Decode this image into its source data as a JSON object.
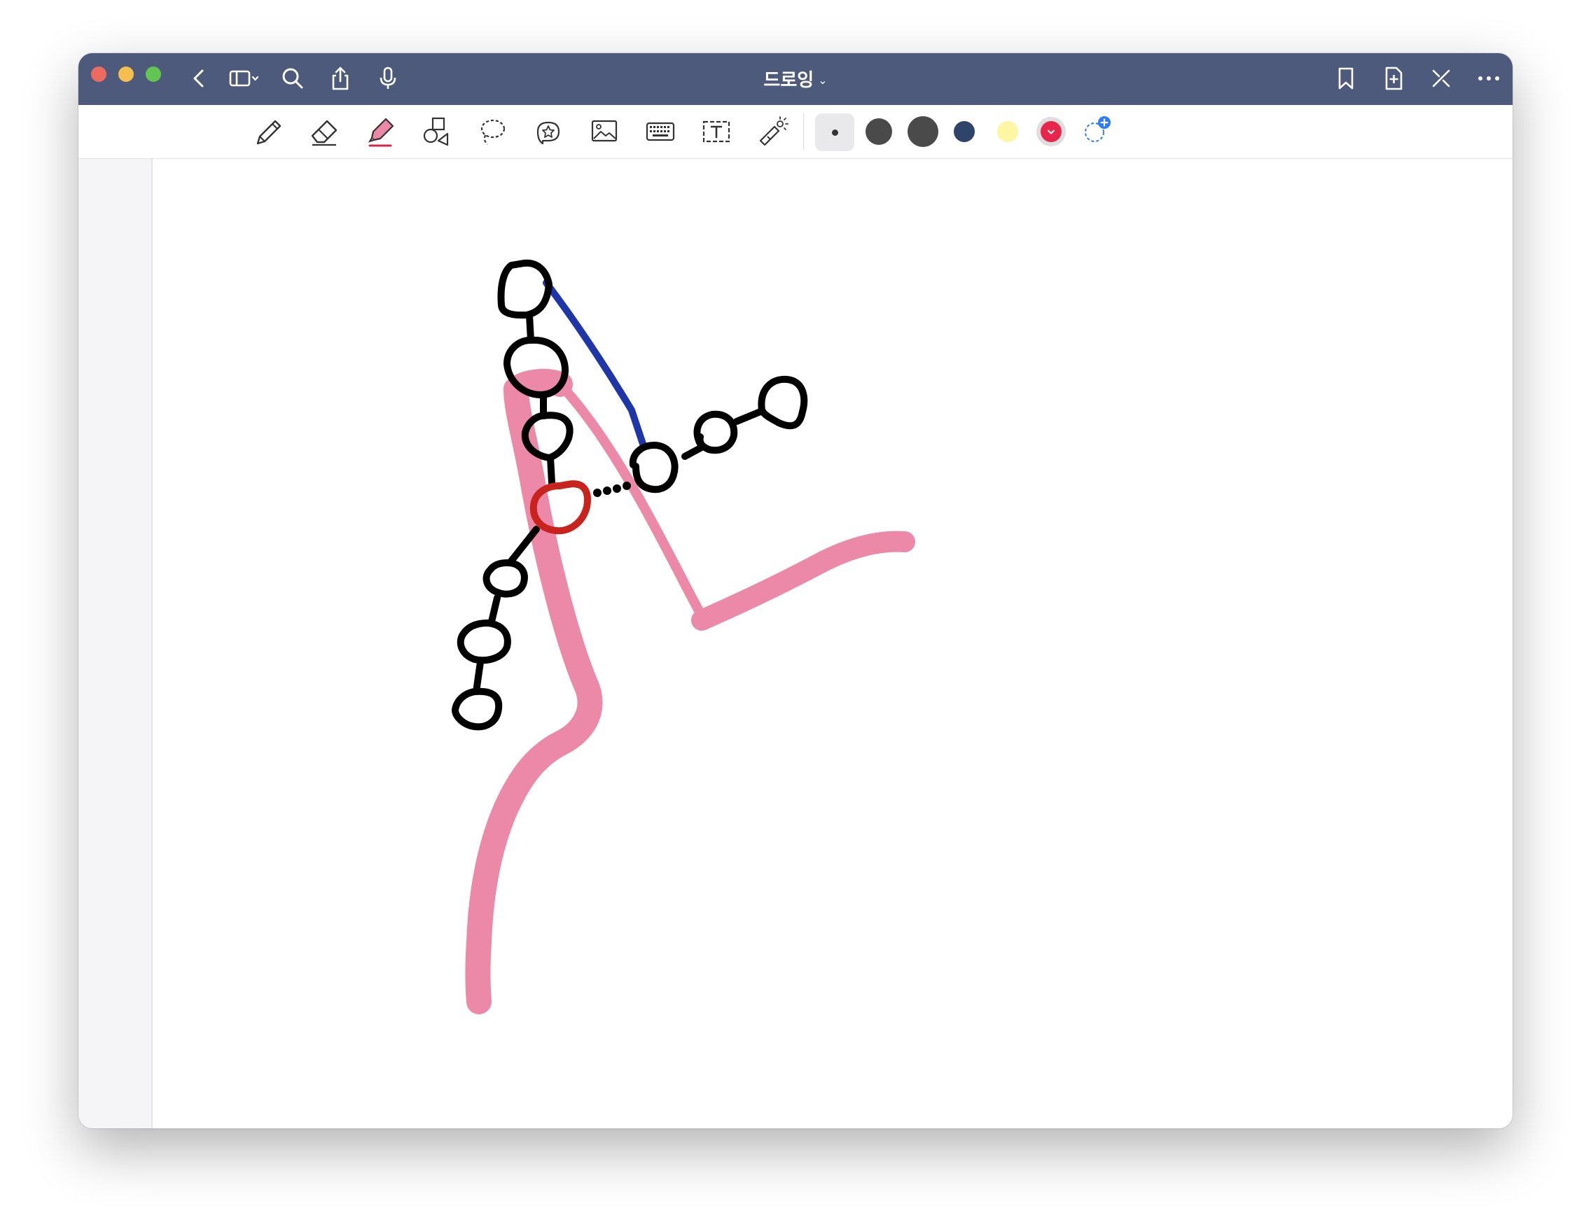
{
  "window": {
    "title": "드로잉",
    "title_chevron": "⌄"
  },
  "titlebar_icons": [
    "back-chevron-icon",
    "sidebar-toggle-icon",
    "search-icon",
    "share-icon",
    "microphone-icon",
    "bookmark-icon",
    "add-page-icon",
    "close-toolbar-icon",
    "more-icon"
  ],
  "toolbar": {
    "tools": [
      "pen",
      "eraser",
      "highlighter",
      "shapes",
      "lasso",
      "sticker",
      "image",
      "keyboard",
      "text-box",
      "laser-pointer"
    ],
    "selected_tool": "highlighter",
    "pen_sizes": [
      "small",
      "medium",
      "large"
    ],
    "selected_size": "small",
    "colors": [
      "#4a4a4a",
      "#2e4468",
      "#fdf7a3",
      "#e8254a"
    ],
    "selected_color": "#e8254a",
    "accent": "#2f7cf6"
  },
  "theme": {
    "titlebar_bg": "#4e5a7c",
    "highlight_pink": "#ec88a8",
    "ink_black": "#000000",
    "ink_blue": "#1f36a8",
    "ink_red": "#c8231c"
  }
}
